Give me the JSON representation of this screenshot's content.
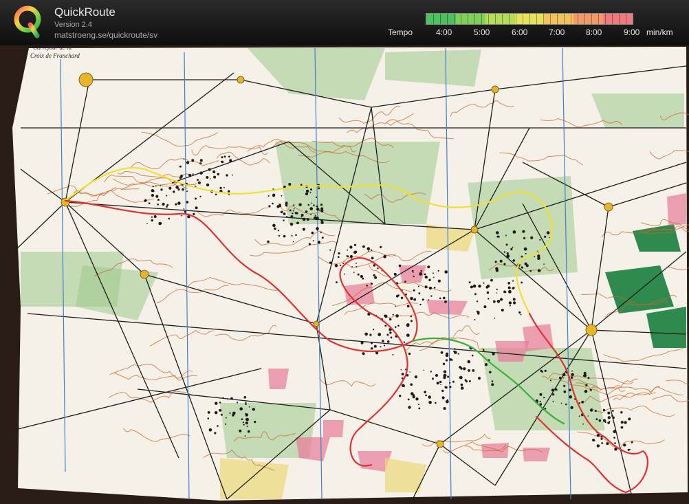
{
  "app": {
    "title": "QuickRoute",
    "version": "Version 2.4",
    "url": "matstroeng.se/quickroute/sv"
  },
  "tempo": {
    "label": "Tempo",
    "ticks": [
      "4:00",
      "5:00",
      "6:00",
      "7:00",
      "8:00",
      "9:00"
    ],
    "unit": "min/km",
    "colors": [
      "#4fbf5f",
      "#7fcf5a",
      "#b6dc5a",
      "#e8e35c",
      "#f2c35e",
      "#f29a6a",
      "#ef7a80"
    ]
  },
  "map": {
    "place_label_line1": "Carrefour de la",
    "place_label_line2": "Croix de Franchard",
    "colors": {
      "paper": "#f6f1e8",
      "contour": "#c46a2c",
      "vegetation_green": "#9cc98a",
      "dark_green": "#2f8a4f",
      "marsh_pink": "#e87a9a",
      "open_yellow": "#ecd978",
      "route_red": "#e03030",
      "route_yellow": "#f0e030",
      "route_green": "#38b038"
    }
  }
}
